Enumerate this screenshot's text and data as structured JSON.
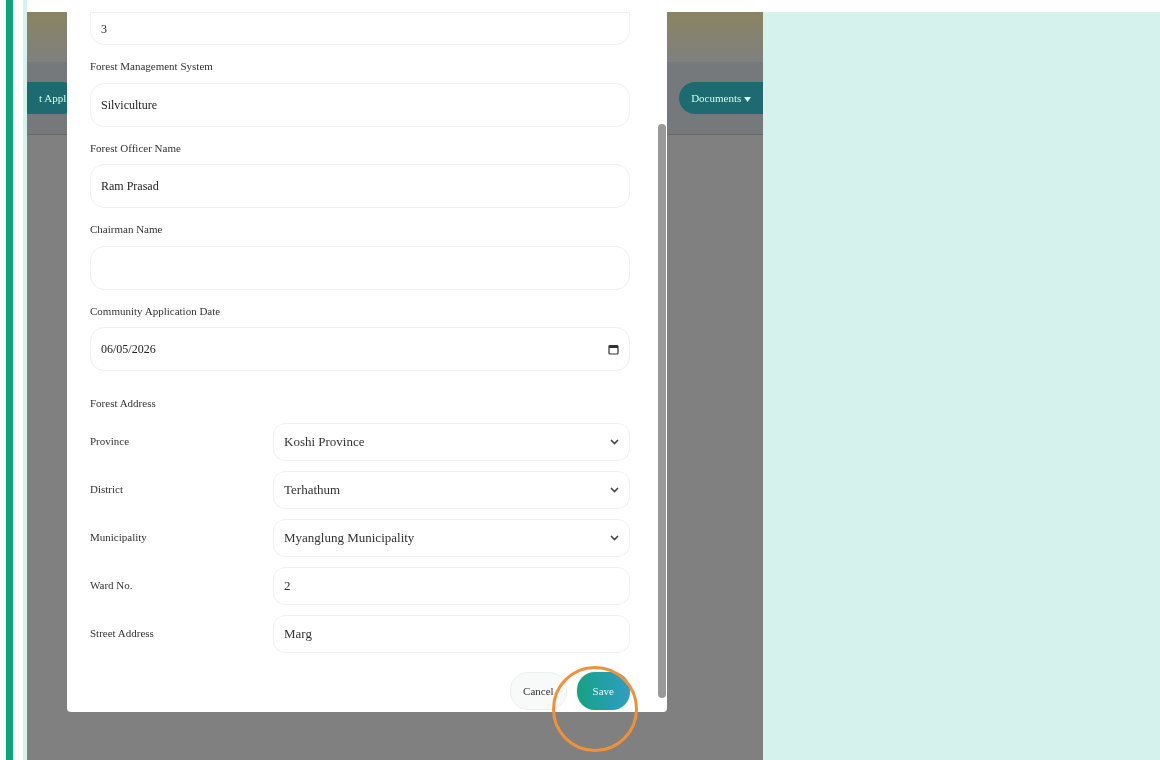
{
  "background": {
    "tabs": [
      {
        "label": "t Appl",
        "dropdown": false
      },
      {
        "label": "Documents",
        "dropdown": true
      }
    ]
  },
  "modal": {
    "fields": [
      {
        "kind": "text",
        "value": "3"
      },
      {
        "kind": "text",
        "label": "Forest Management System",
        "value": "Silviculture"
      },
      {
        "kind": "text",
        "label": "Forest Officer Name",
        "value": "Ram Prasad"
      },
      {
        "kind": "text",
        "label": "Chairman Name"
      },
      {
        "kind": "date",
        "label": "Community Application Date",
        "value": "06/05/2026"
      }
    ],
    "address": {
      "heading": "Forest Address",
      "rows": [
        {
          "kind": "select",
          "label": "Province",
          "value": "Koshi Province"
        },
        {
          "kind": "select",
          "label": "District",
          "value": "Terhathum"
        },
        {
          "kind": "select",
          "label": "Municipality",
          "value": "Myanglung Municipality"
        },
        {
          "kind": "text",
          "label": "Ward No.",
          "value": "2"
        },
        {
          "kind": "text",
          "label": "Street Address",
          "value": "Marg"
        }
      ]
    },
    "buttons": [
      {
        "label": "Cancel",
        "kind": "secondary",
        "highlighted": false
      },
      {
        "label": "Save",
        "kind": "primary",
        "highlighted": true
      }
    ]
  }
}
